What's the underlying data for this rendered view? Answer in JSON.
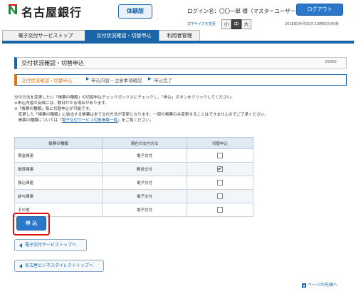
{
  "header": {
    "bank_name": "名古屋銀行",
    "trial_badge": "体験版",
    "login_name": "ログイン名：〇〇一郎 様（マスターユーザー）",
    "logout_label": "ログアウト",
    "font_size_label": "文字サイズを変更",
    "font_sizes": [
      "小",
      "中",
      "大"
    ],
    "font_size_selected": "中",
    "datetime": "2018年04月01日 10時00分00秒"
  },
  "tabs": [
    {
      "label": "電子交付サービストップ",
      "active": false
    },
    {
      "label": "交付状況確認・切替申込",
      "active": true
    },
    {
      "label": "利用者管理",
      "active": false
    }
  ],
  "page": {
    "title": "交付状況確認・切替申込",
    "screen_id": "ES002"
  },
  "steps": [
    {
      "label": "交付状況確認・切替申込",
      "current": true
    },
    {
      "label": "申込内容・注意事項確認",
      "current": false
    },
    {
      "label": "申込完了",
      "current": false
    }
  ],
  "instructions": {
    "line1": "交付方法を変更したい「帳票の種類」の切替申込チェックボックスにチェックし、「申込」ボタンをクリックしてください。",
    "line2": "※申込内容の反映には、数日かかる場合があります。",
    "line3": "※「帳票の種類」毎に切替申込が可能です。",
    "line4": "　変更した「帳票の種類」に該当する帳票は全て交付方法が変更となります。一部の帳票のみ変更することはできませんのでご了承ください。",
    "line5_pre": "　帳票の種類については「",
    "line5_link": "電子交付サービス対象帳票一覧",
    "line5_post": "」をご覧ください。"
  },
  "table": {
    "headers": [
      "帳票の種類",
      "現在の交付方法",
      "切替申込"
    ],
    "rows": [
      {
        "type": "預金関連",
        "method": "電子交付",
        "checked": false
      },
      {
        "type": "融資関連",
        "method": "郵送交付",
        "checked": true
      },
      {
        "type": "振込関連",
        "method": "電子交付",
        "checked": false
      },
      {
        "type": "給与関連",
        "method": "電子交付",
        "checked": false
      },
      {
        "type": "その他",
        "method": "電子交付",
        "checked": false
      }
    ]
  },
  "buttons": {
    "apply": "申 込",
    "back_top": "電子交付サービストップへ",
    "back_direct": "名古屋ビジネスダイレクトトップへ",
    "page_top": "ページの先頭へ"
  },
  "colors": {
    "primary": "#1a64a8",
    "button_blue": "#2b77c9",
    "step_orange": "#e8730a",
    "highlight_red": "#e01010"
  }
}
